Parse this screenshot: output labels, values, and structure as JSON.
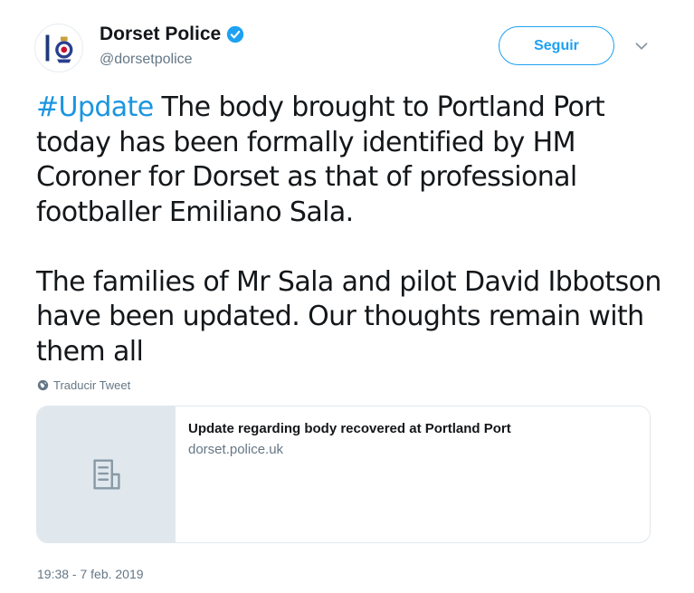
{
  "author": {
    "display_name": "Dorset Police",
    "handle": "@dorsetpolice",
    "verified": true,
    "avatar_icon": "police-crest-icon"
  },
  "actions": {
    "follow_label": "Seguir",
    "more_icon": "chevron-down-icon"
  },
  "tweet": {
    "hashtag": "#Update",
    "paragraph_1_rest": " The body brought to Portland Port today has been formally identified by HM Coroner for Dorset as that of professional footballer Emiliano Sala.",
    "paragraph_2": "The families of Mr Sala and pilot David Ibbotson have been updated. Our thoughts remain with them all",
    "translate_label": "Traducir Tweet",
    "timestamp": "19:38 - 7 feb. 2019"
  },
  "link_card": {
    "title": "Update regarding body recovered at Portland Port",
    "domain": "dorset.police.uk",
    "thumb_icon": "document-icon"
  },
  "colors": {
    "accent": "#1da1f2",
    "hashtag": "#1b95e0",
    "text": "#14171a",
    "muted": "#657786",
    "card_border": "#e1e8ed"
  }
}
